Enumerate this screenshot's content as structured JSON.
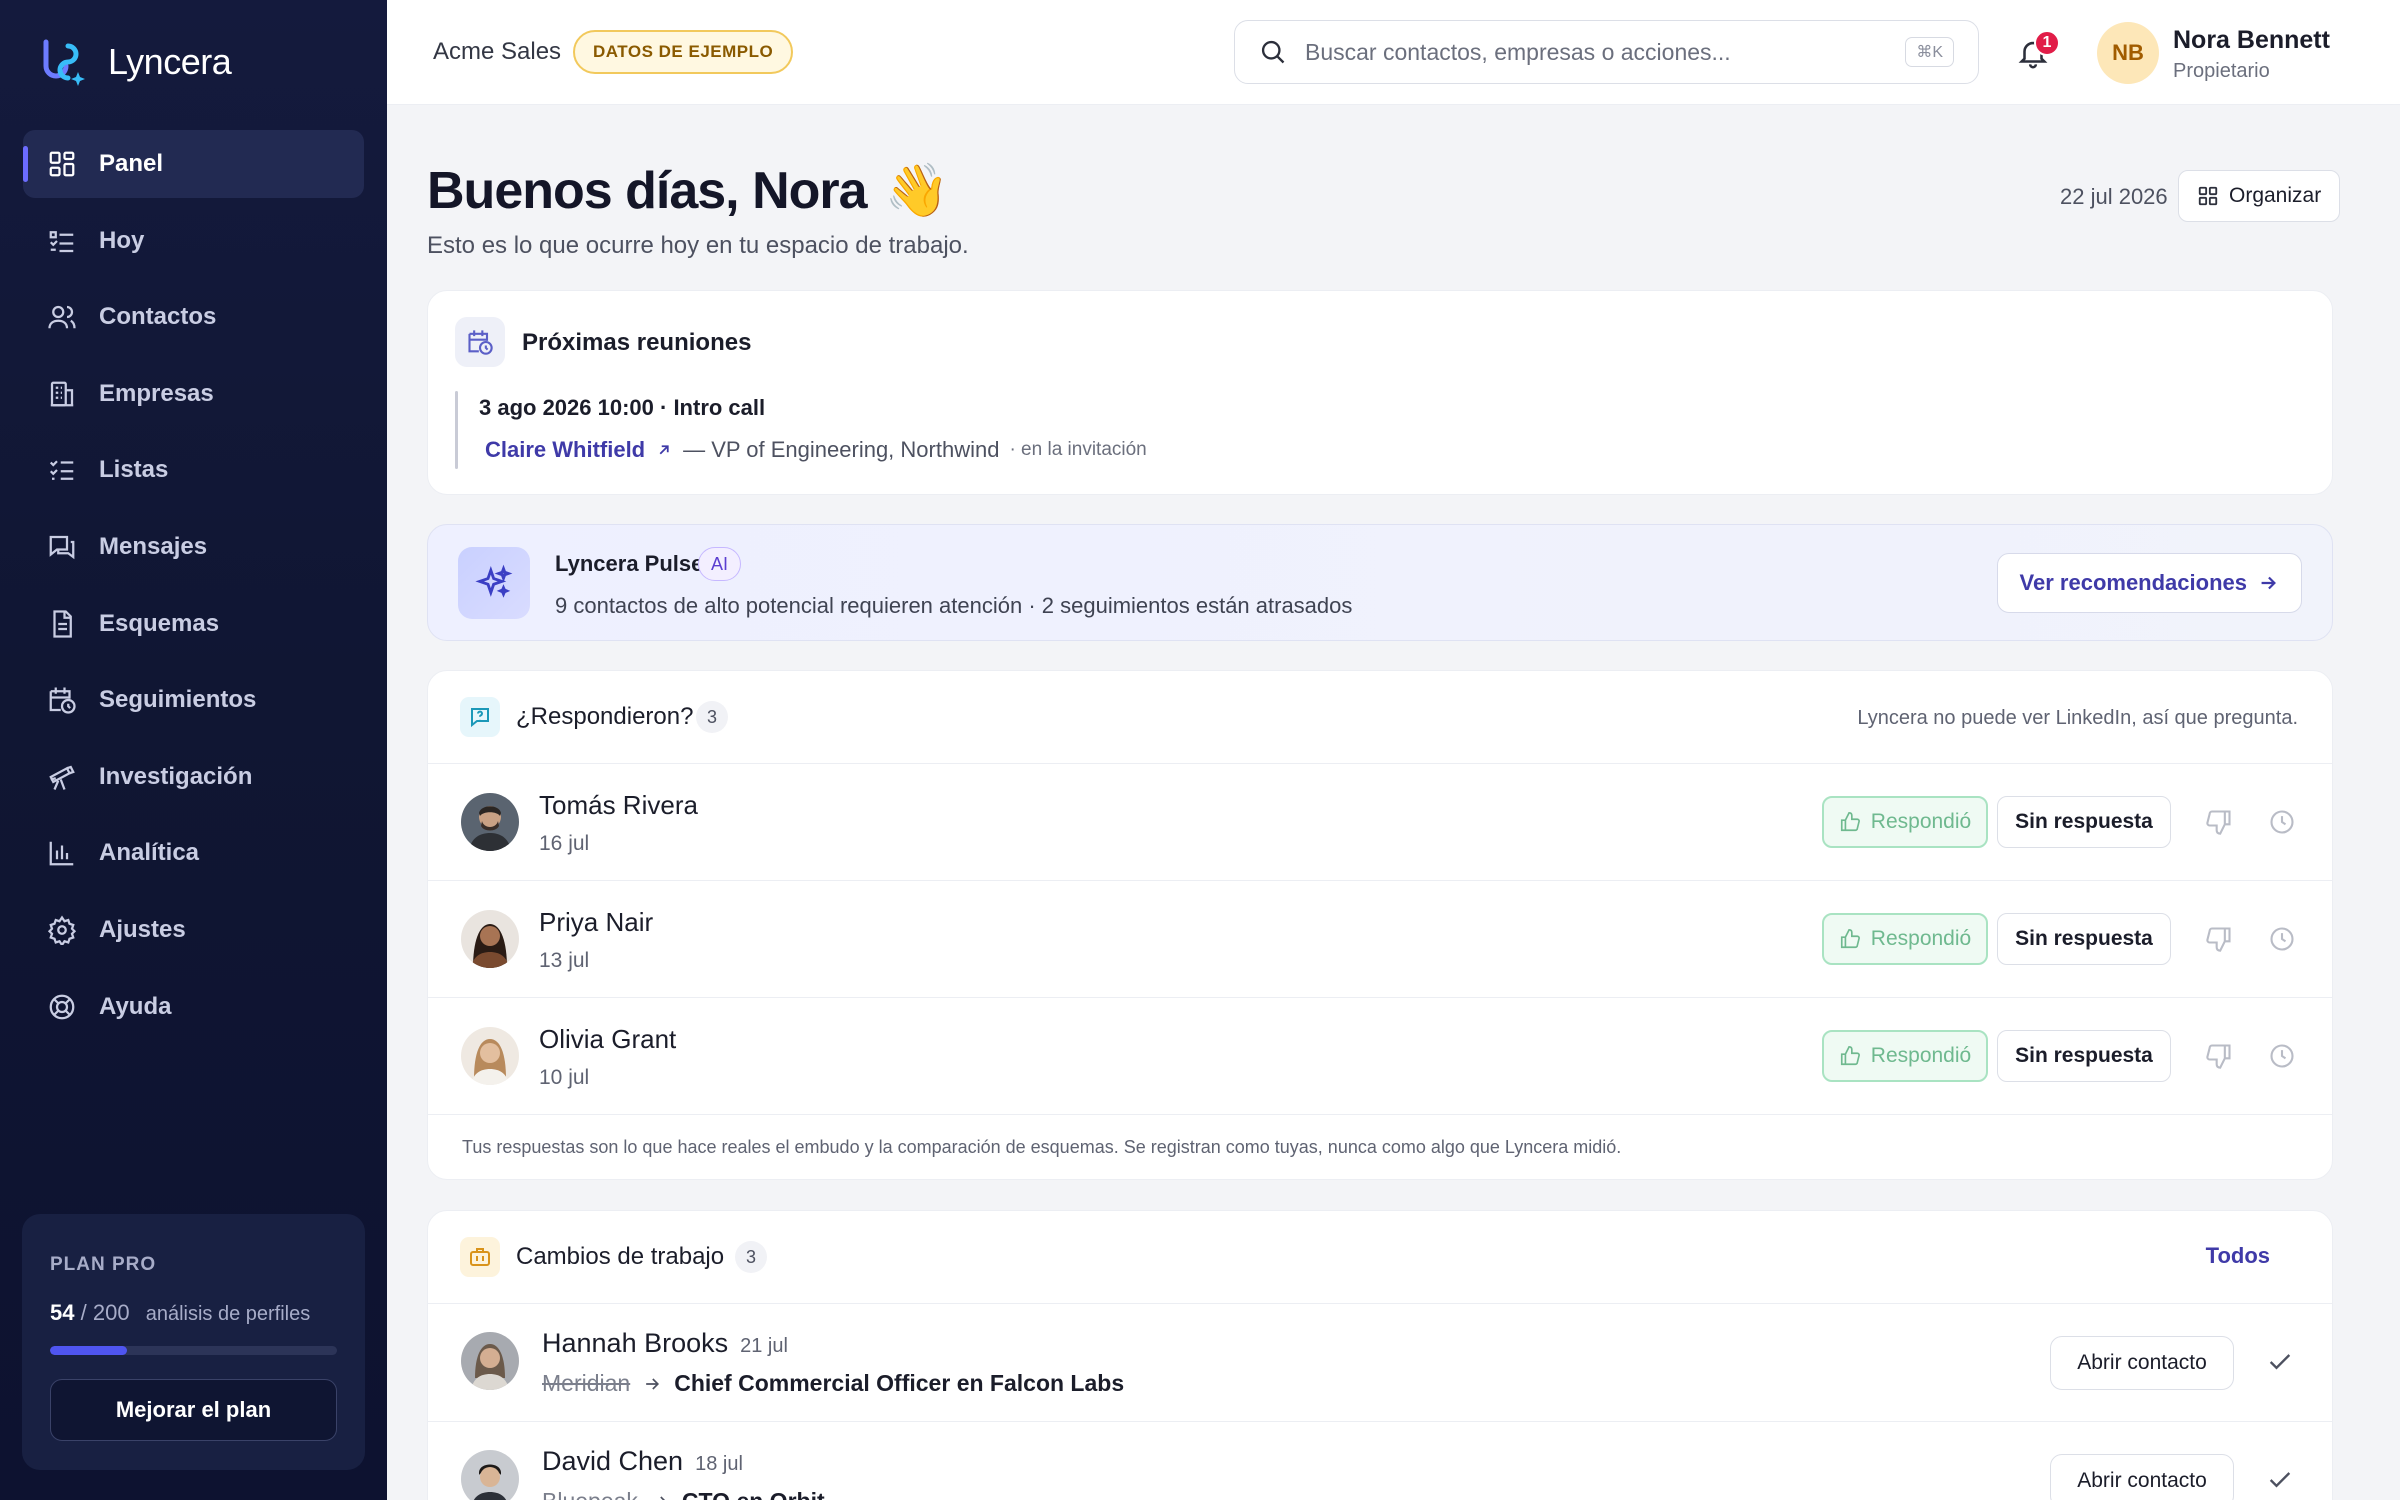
{
  "app": {
    "name": "Lyncera"
  },
  "sidebar": {
    "items": [
      {
        "label": "Panel",
        "icon": "grid-icon"
      },
      {
        "label": "Hoy",
        "icon": "list-checks-icon"
      },
      {
        "label": "Contactos",
        "icon": "users-icon"
      },
      {
        "label": "Empresas",
        "icon": "building-icon"
      },
      {
        "label": "Listas",
        "icon": "checklist-icon"
      },
      {
        "label": "Mensajes",
        "icon": "messages-icon"
      },
      {
        "label": "Esquemas",
        "icon": "document-icon"
      },
      {
        "label": "Seguimientos",
        "icon": "calendar-clock-icon"
      },
      {
        "label": "Investigación",
        "icon": "telescope-icon"
      },
      {
        "label": "Analítica",
        "icon": "bar-chart-icon"
      },
      {
        "label": "Ajustes",
        "icon": "gear-icon"
      },
      {
        "label": "Ayuda",
        "icon": "lifebuoy-icon"
      }
    ],
    "active_index": 0,
    "plan": {
      "label": "PLAN PRO",
      "used": "54",
      "separator": "/",
      "total": "200",
      "suffix": "análisis de perfiles",
      "progress_percent": 27,
      "upgrade_label": "Mejorar el plan"
    }
  },
  "topbar": {
    "workspace": "Acme Sales",
    "sample_badge": "DATOS DE EJEMPLO",
    "search_placeholder": "Buscar contactos, empresas o acciones...",
    "search_shortcut": "⌘K",
    "notification_count": "1",
    "user": {
      "initials": "NB",
      "name": "Nora Bennett",
      "role": "Propietario"
    }
  },
  "header": {
    "greeting": "Buenos días, Nora",
    "emoji": "👋",
    "subtitle": "Esto es lo que ocurre hoy en tu espacio de trabajo.",
    "date": "22 jul 2026",
    "organize_label": "Organizar"
  },
  "meetings": {
    "title": "Próximas reuniones",
    "item": {
      "when": "3 ago 2026 10:00 · Intro call",
      "person": "Claire Whitfield",
      "role": "— VP of Engineering, Northwind",
      "note": "· en la invitación"
    }
  },
  "pulse": {
    "title": "Lyncera Pulse",
    "badge": "AI",
    "text": "9 contactos de alto potencial requieren atención · 2 seguimientos están atrasados",
    "button": "Ver recomendaciones"
  },
  "replies": {
    "title": "¿Respondieron?",
    "count": "3",
    "hint": "Lyncera no puede ver LinkedIn, así que pregunta.",
    "yes_label": "Respondió",
    "no_label": "Sin respuesta",
    "rows": [
      {
        "name": "Tomás Rivera",
        "date": "16 jul"
      },
      {
        "name": "Priya Nair",
        "date": "13 jul"
      },
      {
        "name": "Olivia Grant",
        "date": "10 jul"
      }
    ],
    "footer": "Tus respuestas son lo que hace reales el embudo y la comparación de esquemas. Se registran como tuyas, nunca como algo que Lyncera midió."
  },
  "jobs": {
    "title": "Cambios de trabajo",
    "count": "3",
    "all_label": "Todos",
    "open_label": "Abrir contacto",
    "rows": [
      {
        "name": "Hannah Brooks",
        "date": "21 jul",
        "old": "Meridian",
        "new": "Chief Commercial Officer en Falcon Labs"
      },
      {
        "name": "David Chen",
        "date": "18 jul",
        "old": "Bluepeak",
        "new": "CTO en Orbit"
      }
    ]
  },
  "colors": {
    "sidebar_bg": "#121838",
    "accent": "#4f55f0",
    "link": "#3f3aa8",
    "success_border": "#a9e3c2",
    "badge_border": "#f2c95c"
  }
}
